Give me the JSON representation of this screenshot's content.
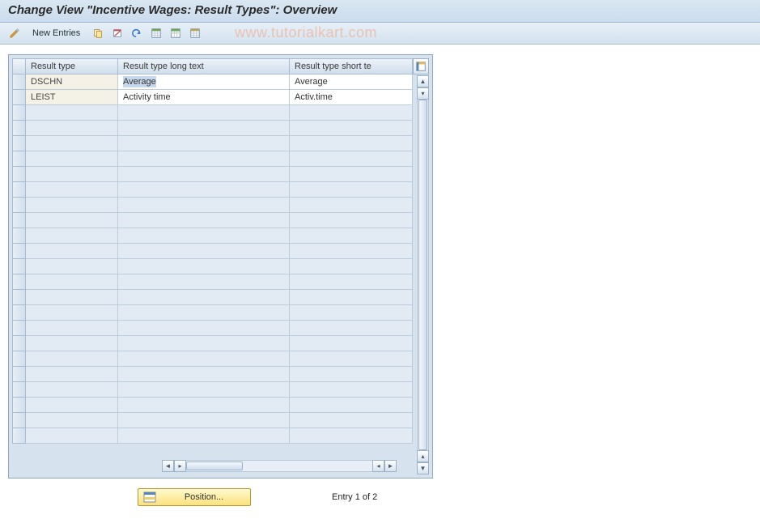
{
  "title": "Change View \"Incentive Wages: Result Types\": Overview",
  "toolbar": {
    "new_entries_label": "New Entries"
  },
  "watermark": "www.tutorialkart.com",
  "grid": {
    "columns": [
      "Result type",
      "Result type long text",
      "Result type short te"
    ],
    "rows": [
      {
        "code": "DSCHN",
        "long": "Average",
        "short": "Average"
      },
      {
        "code": "LEIST",
        "long": "Activity time",
        "short": "Activ.time"
      }
    ],
    "empty_rows": 22
  },
  "footer": {
    "position_label": "Position...",
    "entry_text": "Entry 1 of 2"
  }
}
